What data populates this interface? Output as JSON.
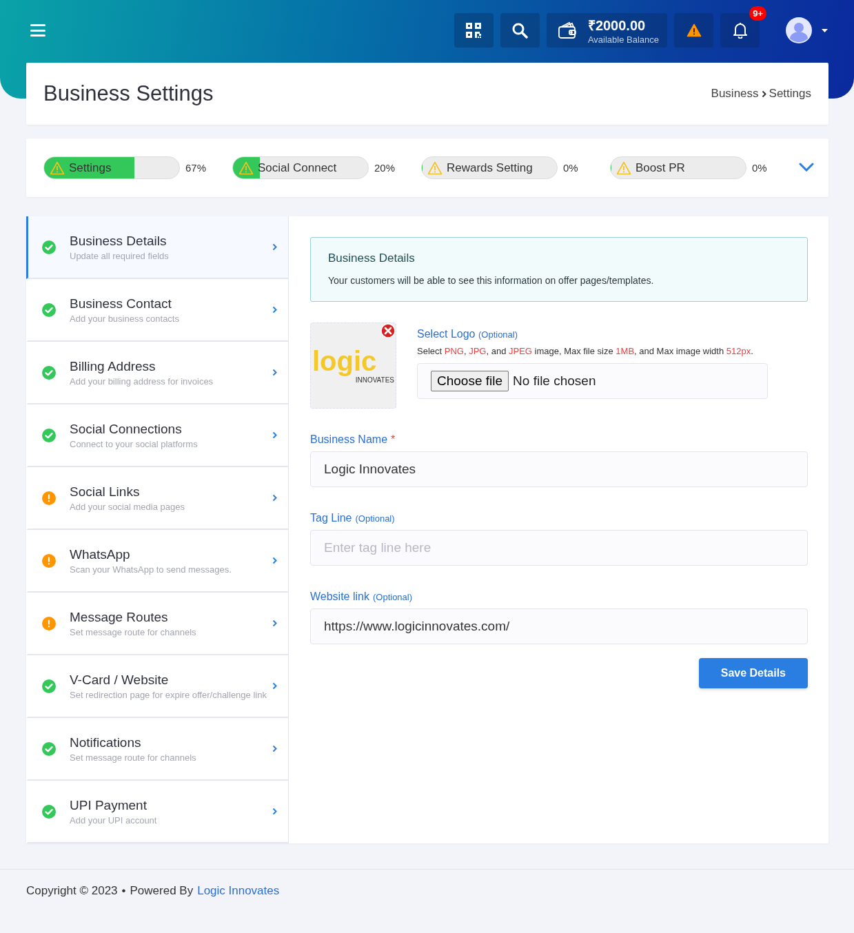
{
  "topbar": {
    "balance": {
      "amount": "₹2000.00",
      "label": "Available Balance"
    },
    "notification_badge": "9+"
  },
  "page": {
    "title": "Business Settings",
    "breadcrumb": [
      "Business",
      "Settings"
    ]
  },
  "progress": [
    {
      "label": "Settings",
      "level": 0.67,
      "reading": "67%"
    },
    {
      "label": "Social Connect",
      "level": 0.2,
      "reading": "20%"
    },
    {
      "label": "Rewards Setting",
      "level": 0,
      "reading": "0%"
    },
    {
      "label": "Boost PR",
      "level": 0,
      "reading": "0%"
    }
  ],
  "sidebar": {
    "items": [
      {
        "title": "Business Details",
        "subtitle": "Update all required fields",
        "kind": "complete",
        "selected": true
      },
      {
        "title": "Business Contact",
        "subtitle": "Add your business contacts",
        "kind": "complete",
        "selected": false
      },
      {
        "title": "Billing Address",
        "subtitle": "Add your billing address for invoices",
        "kind": "complete",
        "selected": false
      },
      {
        "title": "Social Connections",
        "subtitle": "Connect to your social platforms",
        "kind": "complete",
        "selected": false
      },
      {
        "title": "Social Links",
        "subtitle": "Add your social media pages",
        "kind": "pending",
        "selected": false
      },
      {
        "title": "WhatsApp",
        "subtitle": "Scan your WhatsApp to send messages.",
        "kind": "pending",
        "selected": false
      },
      {
        "title": "Message Routes",
        "subtitle": "Set message route for channels",
        "kind": "pending",
        "selected": false
      },
      {
        "title": "V-Card / Website",
        "subtitle": "Set redirection page for expire offer/challenge link",
        "kind": "complete",
        "selected": false
      },
      {
        "title": "Notifications",
        "subtitle": "Set message route for channels",
        "kind": "complete",
        "selected": false
      },
      {
        "title": "UPI Payment",
        "subtitle": "Add your UPI account",
        "kind": "complete",
        "selected": false
      }
    ]
  },
  "info": {
    "title": "Business Details",
    "text": "Your customers will be able to see this information on offer pages/templates."
  },
  "logo": {
    "wordmark": "logic",
    "tagline": "INNOVATES",
    "label": "Select Logo",
    "optional": "(Optional)",
    "hint": "Select **PNG**, **JPG**, and **JPEG** image, Max file size **1MB**, and Max image width **512px**.",
    "button": "Choose file",
    "status": "No file chosen"
  },
  "fields": [
    {
      "label": "Business Name",
      "required_mark": "*",
      "value": "Logic Innovates"
    },
    {
      "label": "Tag Line",
      "optional": "(Optional)",
      "placeholder": "Enter tag line here"
    },
    {
      "label": "Website link",
      "optional": "(Optional)",
      "value": "https://www.logicinnovates.com/"
    }
  ],
  "save_button": "Save Details",
  "footer": {
    "copyright": "Copyright © 2023",
    "separator": "•",
    "powered_by": "Powered By",
    "link": "Logic Innovates"
  }
}
